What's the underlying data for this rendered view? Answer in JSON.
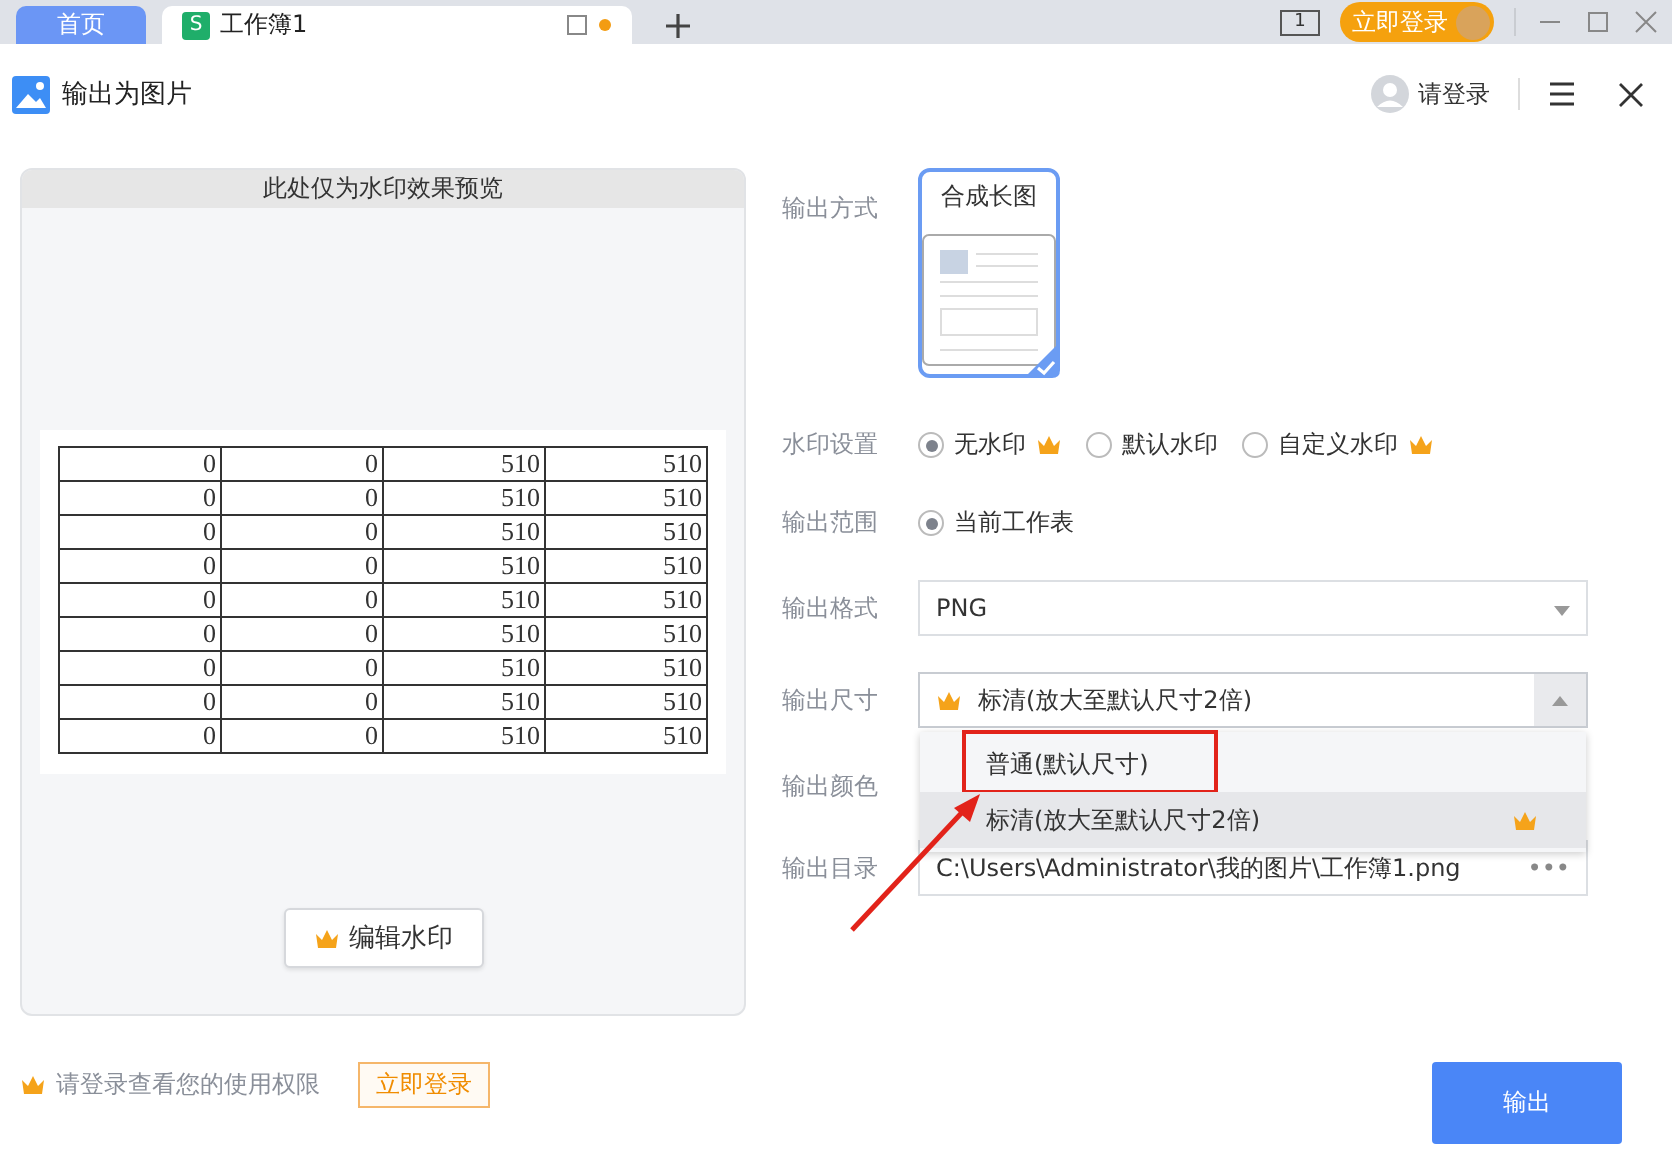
{
  "browser_tabs": [
    {
      "kind": "home",
      "label": "首页",
      "selected": false
    },
    {
      "kind": "doc",
      "label": "工作簿1",
      "icon_letter": "S",
      "selected": true,
      "modified": true
    }
  ],
  "screen_count": "1",
  "top_login_button": "立即登录",
  "dialog": {
    "title": "输出为图片",
    "login_link": "请登录"
  },
  "preview": {
    "title": "此处仅为水印效果预览",
    "rows": [
      [
        "0",
        "0",
        "510",
        "510"
      ],
      [
        "0",
        "0",
        "510",
        "510"
      ],
      [
        "0",
        "0",
        "510",
        "510"
      ],
      [
        "0",
        "0",
        "510",
        "510"
      ],
      [
        "0",
        "0",
        "510",
        "510"
      ],
      [
        "0",
        "0",
        "510",
        "510"
      ],
      [
        "0",
        "0",
        "510",
        "510"
      ],
      [
        "0",
        "0",
        "510",
        "510"
      ],
      [
        "0",
        "0",
        "510",
        "510"
      ]
    ],
    "edit_button": "编辑水印"
  },
  "form": [
    {
      "kind": "cards",
      "label": "输出方式",
      "options": [
        {
          "label": "合成长图",
          "selected": true
        }
      ]
    },
    {
      "kind": "radios",
      "label": "水印设置",
      "options": [
        {
          "label": "无水印",
          "selected": true,
          "premium": true
        },
        {
          "label": "默认水印",
          "selected": false,
          "premium": false
        },
        {
          "label": "自定义水印",
          "selected": false,
          "premium": true
        }
      ]
    },
    {
      "kind": "radios",
      "label": "输出范围",
      "options": [
        {
          "label": "当前工作表",
          "selected": true,
          "premium": false
        }
      ]
    },
    {
      "kind": "select",
      "label": "输出格式",
      "value": "PNG",
      "premium": false,
      "expanded": false
    },
    {
      "kind": "select",
      "label": "输出尺寸",
      "value": "标清(放大至默认尺寸2倍)",
      "premium": true,
      "expanded": true,
      "options": [
        {
          "label": "普通(默认尺寸)",
          "selected": false,
          "premium": false,
          "annotated": true
        },
        {
          "label": "标清(放大至默认尺寸2倍)",
          "selected": true,
          "premium": true,
          "annotated": false
        }
      ]
    },
    {
      "kind": "covered",
      "label": "输出颜色"
    },
    {
      "kind": "path",
      "label": "输出目录",
      "value": "C:\\Users\\Administrator\\我的图片\\工作簿1.png",
      "browse": "•••"
    }
  ],
  "footer": {
    "notice": "请登录查看您的使用权限",
    "login_button": "立即登录"
  },
  "export_button": "输出"
}
